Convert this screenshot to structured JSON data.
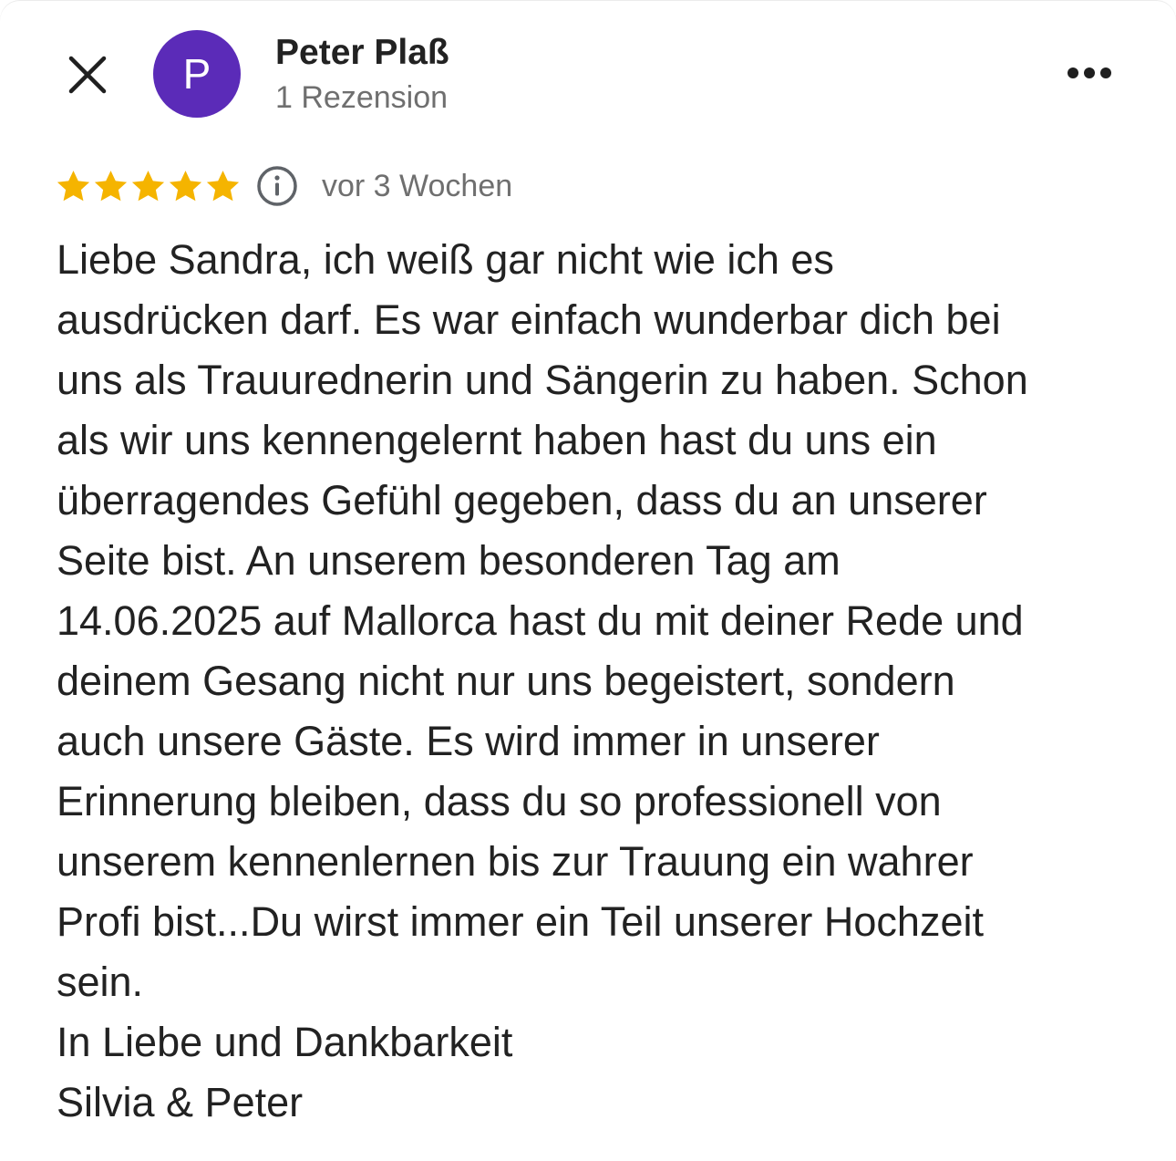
{
  "reviewer": {
    "name": "Peter Plaß",
    "meta": "1 Rezension",
    "avatar_letter": "P",
    "avatar_color": "#5b2bb8"
  },
  "rating": {
    "stars": 5,
    "max_stars": 5,
    "star_color": "#f5b400",
    "time_ago": "vor 3 Wochen"
  },
  "review": {
    "text": "Liebe Sandra, ich weiß gar nicht wie ich es\nausdrücken darf. Es war einfach wunderbar dich bei\nuns als Trauurednerin und Sängerin zu haben. Schon\nals wir uns kennengelernt haben hast du uns ein\nüberragendes Gefühl gegeben, dass du an unserer\nSeite bist. An unserem besonderen Tag am\n14.06.2025 auf Mallorca hast du mit deiner Rede und\ndeinem Gesang nicht nur uns begeistert, sondern\nauch unsere Gäste. Es wird immer in unserer\nErinnerung bleiben, dass du so professionell von\nunserem kennenlernen bis zur Trauung ein wahrer\nProfi bist...Du wirst immer ein Teil unserer Hochzeit\nsein.\nIn Liebe und Dankbarkeit\nSilvia & Peter"
  },
  "icons": {
    "close": "close-icon",
    "more": "more-options-icon",
    "info": "info-icon",
    "star": "star-icon"
  }
}
